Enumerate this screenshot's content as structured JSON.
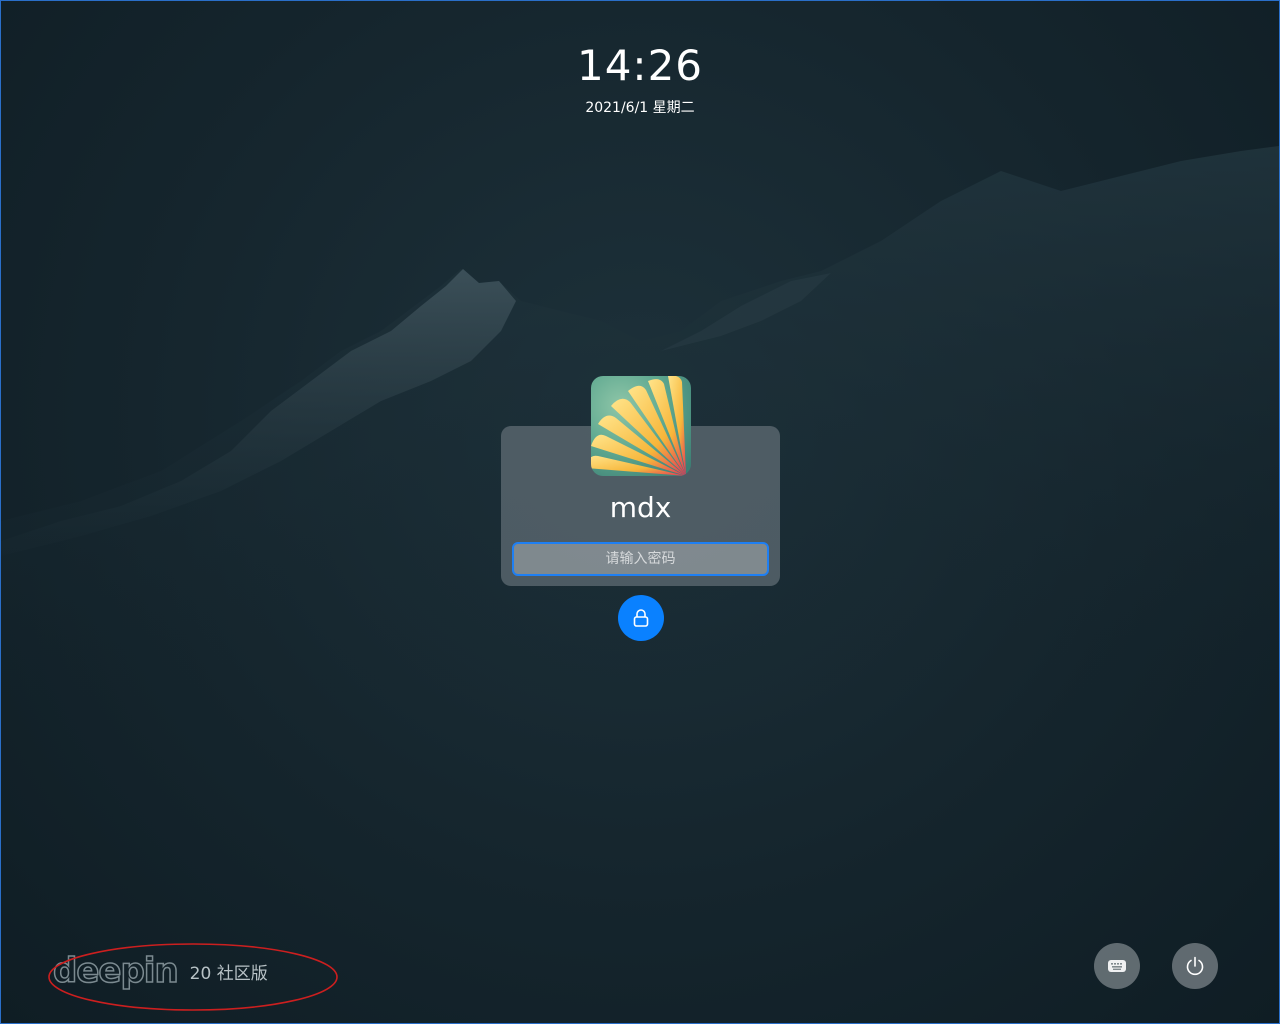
{
  "lockscreen": {
    "time": "14:26",
    "date": "2021/6/1 星期二"
  },
  "user": {
    "name": "mdx",
    "avatar": "flower-petals-avatar"
  },
  "password": {
    "placeholder": "请输入密码",
    "value": ""
  },
  "buttons": {
    "unlock": {
      "icon": "lock-icon",
      "color": "#0a81ff"
    },
    "keyboard": {
      "icon": "keyboard-icon"
    },
    "power": {
      "icon": "power-icon"
    }
  },
  "branding": {
    "logo_text": "deepin",
    "edition": "20 社区版"
  },
  "colors": {
    "accent": "#1e7ff3",
    "annotation": "#cc1f1f",
    "background": "#15252d"
  }
}
